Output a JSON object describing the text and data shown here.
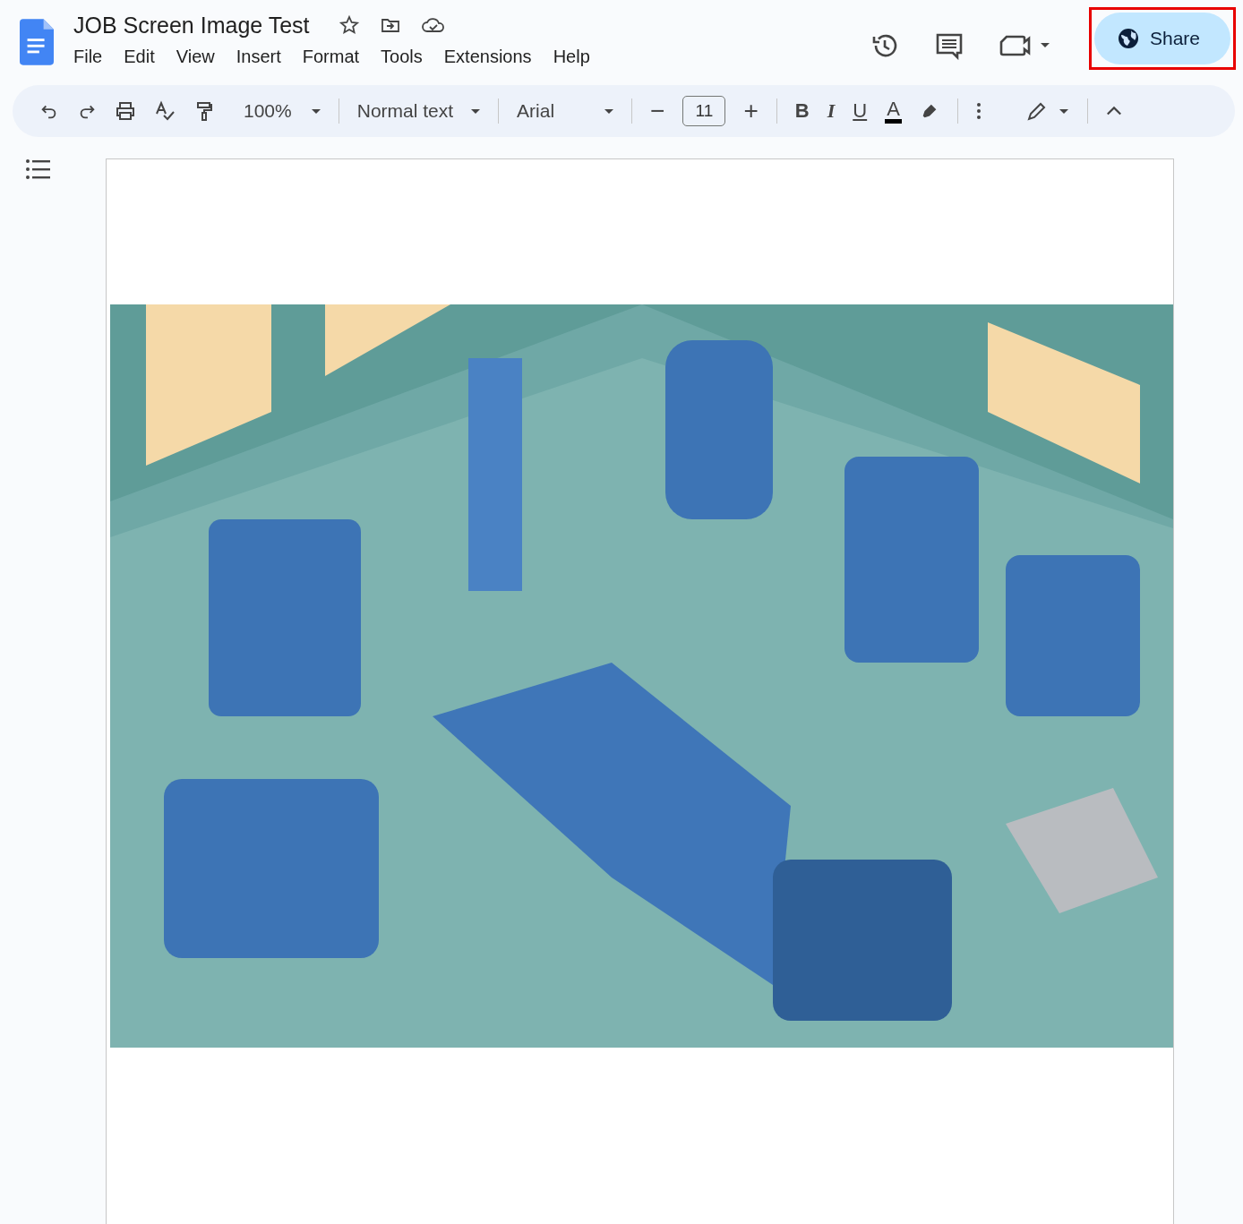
{
  "document": {
    "title": "JOB Screen Image Test"
  },
  "menu": [
    "File",
    "Edit",
    "View",
    "Insert",
    "Format",
    "Tools",
    "Extensions",
    "Help"
  ],
  "share": {
    "label": "Share",
    "highlighted": true
  },
  "toolbar": {
    "zoom": "100%",
    "style": "Normal text",
    "font": "Arial",
    "font_size": "11",
    "minus": "−",
    "plus": "+",
    "format_buttons": [
      {
        "kind": "bold",
        "label": "B"
      },
      {
        "kind": "italic",
        "label": "I"
      },
      {
        "kind": "underline",
        "label": "U"
      },
      {
        "kind": "color",
        "label": "A",
        "color": "#000000"
      }
    ]
  }
}
